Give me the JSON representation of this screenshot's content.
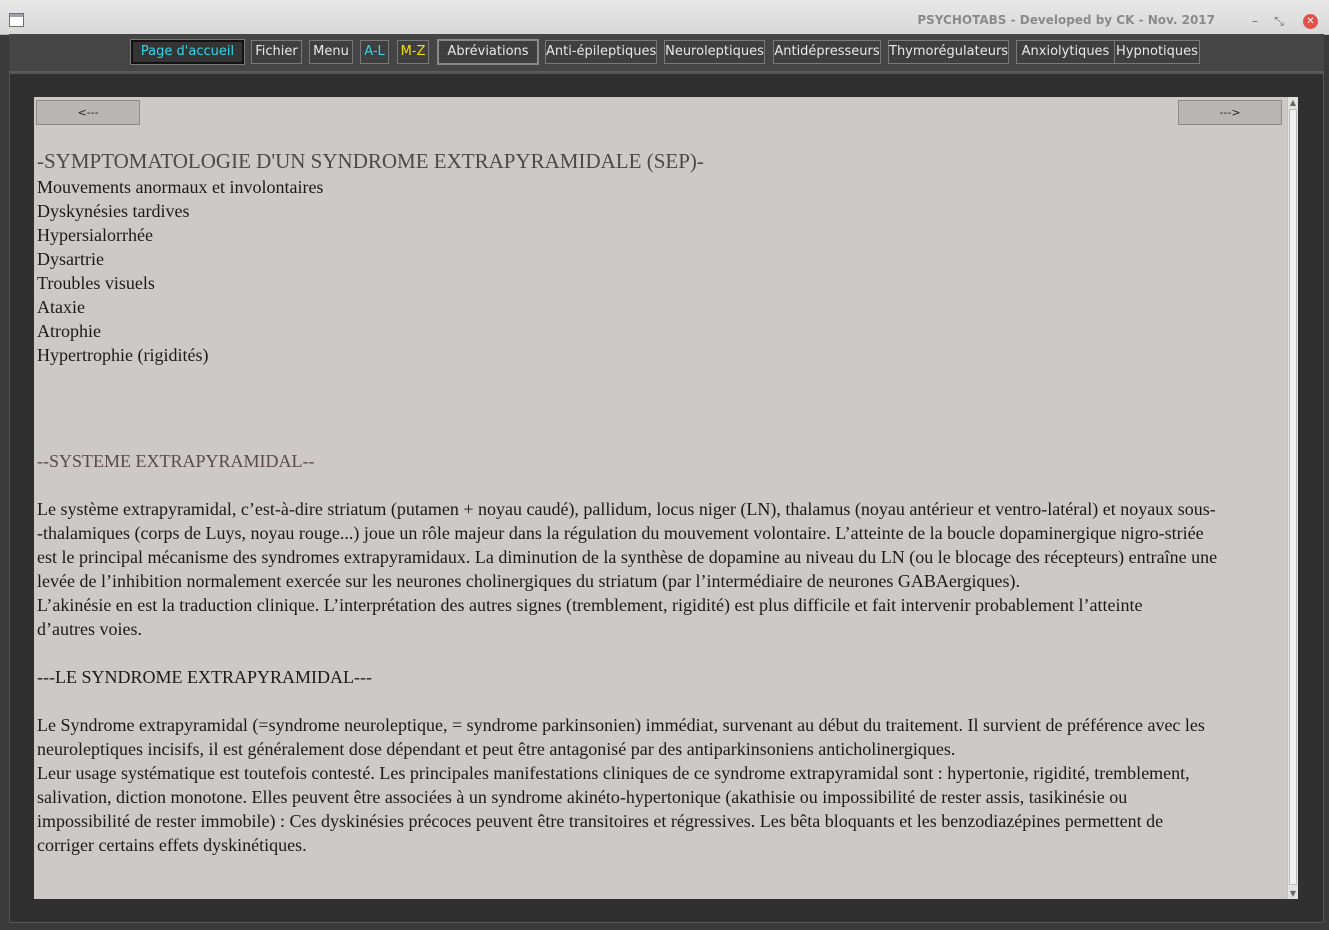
{
  "window": {
    "title": "PSYCHOTABS - Developed by CK - Nov. 2017",
    "min_glyph": "–",
    "max_glyph": "⤡",
    "close_glyph": "✕"
  },
  "nav": {
    "home": "Page d'accueil",
    "fichier": "Fichier",
    "menu": "Menu",
    "al": "A-L",
    "mz": "M-Z",
    "abreviations": "Abréviations",
    "antiepileptiques": "Anti-épileptiques",
    "neuroleptiques": "Neuroleptiques",
    "antidepresseurs": "Antidépresseurs",
    "thymoregulateurs": "Thymorégulateurs",
    "anxiolytiques": "Anxiolytiques",
    "hypnotiques": "Hypnotiques"
  },
  "pager": {
    "prev": "<---",
    "next": "--->"
  },
  "content": {
    "heading1": "-SYMPTOMATOLOGIE D'UN SYNDROME EXTRAPYRAMIDALE (SEP)-",
    "symptoms": [
      "Mouvements anormaux et involontaires",
      "Dyskynésies tardives",
      "Hypersialorrhée",
      "Dysartrie",
      "Troubles visuels",
      "Ataxie",
      "Atrophie",
      "Hypertrophie (rigidités)"
    ],
    "heading2": "--SYSTEME EXTRAPYRAMIDAL--",
    "system_lines": [
      "Le système extrapyramidal, c’est-à-dire striatum (putamen + noyau caudé), pallidum, locus niger (LN), thalamus (noyau antérieur et ventro-latéral) et noyaux sous-",
      "-thalamiques  (corps  de  Luys, noyau rouge...) joue un rôle majeur dans la régulation du mouvement volontaire. L’atteinte de la boucle dopaminergique nigro-striée",
      "est le principal mécanisme des syndromes extrapyramidaux. La diminution de la synthèse de dopamine au niveau du LN (ou le blocage des récepteurs) entraîne une",
      "levée de l’inhibition normalement exercée sur les neurones cholinergiques du striatum (par l’intermédiaire de neurones GABAergiques).",
      "L’akinésie en est la traduction clinique. L’interprétation des autres signes (tremblement, rigidité) est plus difficile et fait intervenir probablement l’atteinte",
      "d’autres voies."
    ],
    "heading3": "---LE SYNDROME EXTRAPYRAMIDAL---",
    "syndrome_lines": [
      "Le Syndrome extrapyramidal (=syndrome neuroleptique, = syndrome parkinsonien) immédiat, survenant au début du traitement. Il survient de préférence avec les",
      "neuroleptiques incisifs, il est généralement dose dépendant et peut être antagonisé par des antiparkinsoniens anticholinergiques.",
      "Leur usage systématique est toutefois contesté. Les principales manifestations cliniques de ce syndrome extrapyramidal sont : hypertonie, rigidité, tremblement,",
      "salivation, diction monotone. Elles peuvent être associées à un syndrome akinéto-hypertonique (akathisie ou impossibilité de rester assis, tasikinésie ou",
      "impossibilité de rester immobile) : Ces dyskinésies précoces peuvent être transitoires et régressives. Les bêta bloquants et les benzodiazépines permettent de",
      "corriger certains effets dyskinétiques."
    ]
  },
  "scrollbar": {
    "up_glyph": "▲",
    "down_glyph": "▼"
  }
}
